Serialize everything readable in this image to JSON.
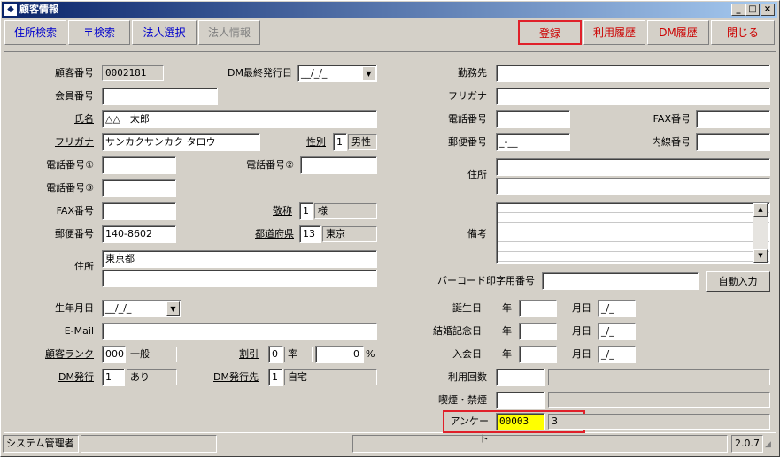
{
  "window": {
    "title": "顧客情報",
    "minimize": "_",
    "maximize": "□",
    "close": "×"
  },
  "toolbar": {
    "address_search": "住所検索",
    "postal_search": "〒検索",
    "corp_select": "法人選択",
    "corp_info": "法人情報",
    "register": "登録",
    "usage_history": "利用履歴",
    "dm_history": "DM履歴",
    "close": "閉じる"
  },
  "form": {
    "customer_no": {
      "label": "顧客番号",
      "value": "0002181"
    },
    "dm_last_issue": {
      "label": "DM最終発行日",
      "value": "__/_/_"
    },
    "member_no": {
      "label": "会員番号",
      "value": ""
    },
    "name": {
      "label": "氏名",
      "value": "△△　太郎"
    },
    "furigana": {
      "label": "フリガナ",
      "value": "サンカクサンカク タロウ"
    },
    "gender": {
      "label": "性別",
      "code": "1",
      "value": "男性"
    },
    "phone1": {
      "label": "電話番号①",
      "value": ""
    },
    "phone2": {
      "label": "電話番号②",
      "value": ""
    },
    "phone3": {
      "label": "電話番号③",
      "value": ""
    },
    "fax": {
      "label": "FAX番号",
      "value": ""
    },
    "honorific": {
      "label": "敬称",
      "code": "1",
      "value": "様"
    },
    "postal": {
      "label": "郵便番号",
      "value": "140-8602"
    },
    "prefecture": {
      "label": "都道府県",
      "code": "13",
      "value": "東京"
    },
    "address": {
      "label": "住所",
      "line1": "東京都",
      "line2": ""
    },
    "birthdate": {
      "label": "生年月日",
      "value": "__/_/_"
    },
    "email": {
      "label": "E-Mail",
      "value": ""
    },
    "rank": {
      "label": "顧客ランク",
      "code": "000",
      "value": "一般"
    },
    "discount": {
      "label": "割引",
      "code": "0",
      "type": "率",
      "value": "0",
      "unit": "%"
    },
    "dm_issue": {
      "label": "DM発行",
      "code": "1",
      "value": "あり"
    },
    "dm_dest": {
      "label": "DM発行先",
      "code": "1",
      "value": "自宅"
    }
  },
  "right": {
    "work": {
      "label": "勤務先",
      "value": ""
    },
    "work_kana": {
      "label": "フリガナ",
      "value": ""
    },
    "work_phone": {
      "label": "電話番号",
      "value": ""
    },
    "work_fax": {
      "label": "FAX番号",
      "value": ""
    },
    "work_postal": {
      "label": "郵便番号",
      "value": "_-__"
    },
    "extension": {
      "label": "内線番号",
      "value": ""
    },
    "work_address": {
      "label": "住所",
      "line1": "",
      "line2": ""
    },
    "memo": {
      "label": "備考",
      "value": ""
    },
    "barcode": {
      "label": "バーコード印字用番号",
      "value": "",
      "button": "自動入力"
    },
    "birthday": {
      "label": "誕生日",
      "year_label": "年",
      "year": "",
      "monthday_label": "月日",
      "monthday": "_/_"
    },
    "anniversary": {
      "label": "結婚記念日",
      "year_label": "年",
      "year": "",
      "monthday_label": "月日",
      "monthday": "_/_"
    },
    "join_date": {
      "label": "入会日",
      "year_label": "年",
      "year": "",
      "monthday_label": "月日",
      "monthday": "_/_"
    },
    "usage_count": {
      "label": "利用回数",
      "value": ""
    },
    "smoking": {
      "label": "喫煙・禁煙",
      "value": ""
    },
    "survey": {
      "label": "アンケート",
      "code": "00003",
      "value": "3"
    }
  },
  "statusbar": {
    "user": "システム管理者",
    "version": "2.0.7"
  },
  "colors": {
    "accent_red": "#e0202a",
    "link_blue": "#0000cc",
    "highlight_yellow": "#ffff00"
  }
}
